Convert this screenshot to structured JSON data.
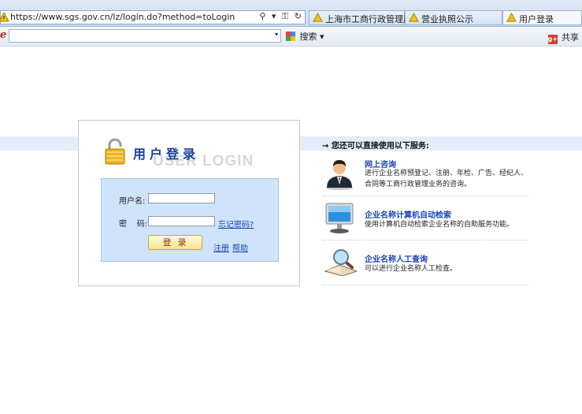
{
  "browser": {
    "url": "https://www.sgs.gov.cn/lz/login.do?method=toLogin",
    "address_icons": "⚲ ▾ ⚿ ↻",
    "tabs": [
      {
        "label": "上海市工商行政管理局"
      },
      {
        "label": "营业执照公示"
      },
      {
        "label": "用户登录"
      }
    ]
  },
  "toolbar": {
    "logo": "e",
    "search_dropdown": "▾",
    "search_label": "搜索",
    "search_dropdown2": "▾",
    "share_label": "共享",
    "share_icon_text": "g+"
  },
  "login": {
    "title": "用户登录",
    "watermark": "USER LOGIN",
    "username_label": "用户名:",
    "password_label": "密    码:",
    "forgot_label": "忘记密码?",
    "submit_label": "登录",
    "register_label": "注册",
    "help_label": "帮助"
  },
  "services": {
    "heading": "→ 您还可以直接使用以下服务:",
    "items": [
      {
        "title": "网上咨询",
        "desc": "进行企业名称预登记、注册、年检、广告、经纪人、合同等工商行政管理业务的咨询。"
      },
      {
        "title": "企业名称计算机自动检索",
        "desc": "使用计算机自动检索企业名称的自助服务功能。"
      },
      {
        "title": "企业名称人工查询",
        "desc": "可以进行企业名称人工检查。"
      }
    ]
  }
}
